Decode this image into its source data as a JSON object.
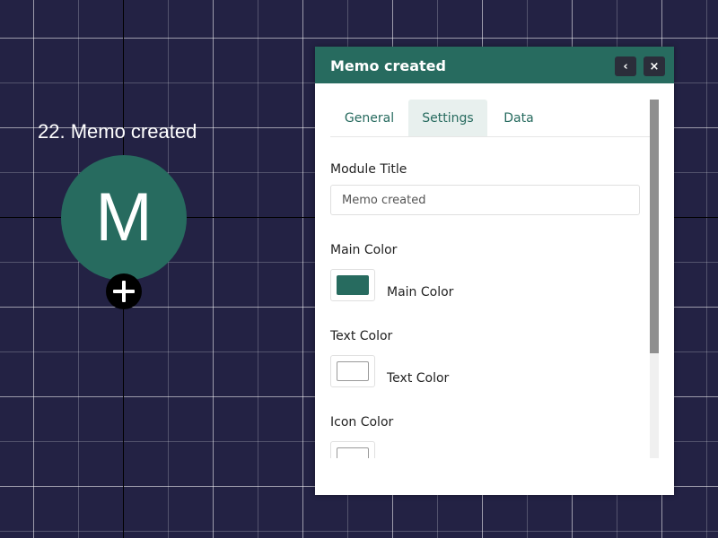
{
  "node": {
    "label": "22. Memo created",
    "letter": "M",
    "color": "#276b5f"
  },
  "panel": {
    "title": "Memo created",
    "collapse_icon": "chevron-left-icon",
    "collapse_glyph": "‹",
    "close_icon": "close-icon",
    "close_glyph": "×",
    "tabs": {
      "general": "General",
      "settings": "Settings",
      "data": "Data"
    },
    "active_tab": "Settings",
    "fields": {
      "module_title_label": "Module Title",
      "module_title_value": "Memo created",
      "main_color_label": "Main Color",
      "main_color_caption": "Main Color",
      "main_color_value": "#276b5f",
      "text_color_label": "Text Color",
      "text_color_caption": "Text Color",
      "text_color_value": "#ffffff",
      "icon_color_label": "Icon Color",
      "icon_color_value": "#ffffff"
    }
  },
  "colors": {
    "canvas_bg": "#232244",
    "accent": "#276b5f",
    "header_button": "#2b2d3a"
  }
}
